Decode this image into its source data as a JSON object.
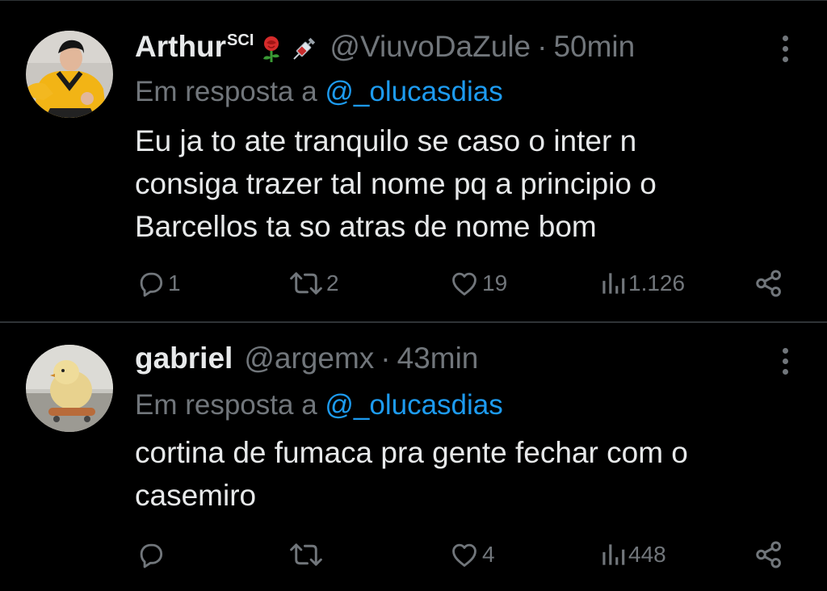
{
  "tweets": [
    {
      "display_name": "Arthur",
      "name_sup": "SCI",
      "name_emojis": [
        "rose-emoji",
        "syringe-emoji"
      ],
      "handle": "@ViuvoDaZule",
      "separator": "·",
      "time": "50min",
      "reply_prefix": "Em resposta a",
      "reply_mention": "@_olucasdias",
      "text_lines": [
        "Eu ja to ate tranquilo se caso o inter n",
        "consiga trazer tal nome pq a principio o",
        "Barcellos ta so atras de nome bom"
      ],
      "replies": "1",
      "retweets": "2",
      "likes": "19",
      "views": "1.126"
    },
    {
      "display_name": "gabriel",
      "handle": "@argemx",
      "separator": "·",
      "time": "43min",
      "reply_prefix": "Em resposta a",
      "reply_mention": "@_olucasdias",
      "text_lines": [
        "cortina de fumaca pra gente fechar com o",
        "casemiro"
      ],
      "replies": "",
      "retweets": "",
      "likes": "4",
      "views": "448"
    }
  ],
  "icons": {
    "reply": "reply-icon",
    "retweet": "retweet-icon",
    "like": "heart-icon",
    "views": "views-icon",
    "share": "share-icon",
    "more": "more-icon"
  },
  "colors": {
    "background": "#000000",
    "text": "#e7e9ea",
    "muted": "#71767b",
    "link": "#1d9bf0",
    "divider": "#2f3336"
  }
}
